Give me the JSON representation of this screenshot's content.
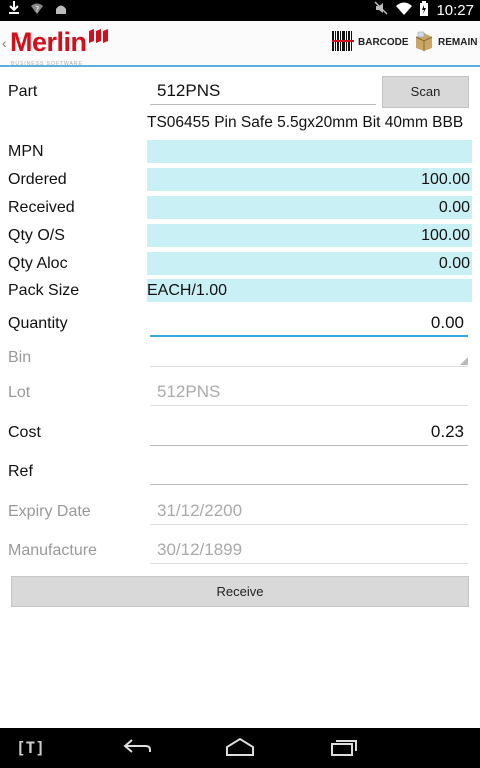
{
  "status_bar": {
    "time": "10:27",
    "icons": [
      "download-icon",
      "wifi-question-icon",
      "android-icon",
      "mute-icon",
      "wifi-icon",
      "battery-icon"
    ]
  },
  "action_bar": {
    "logo_text": "Merlin",
    "logo_tagline": "BUSINESS SOFTWARE",
    "barcode_label": "BARCODE",
    "remain_label": "REMAIN"
  },
  "form": {
    "part": {
      "label": "Part",
      "value": "512PNS",
      "scan_label": "Scan"
    },
    "description": "TS06455 Pin Safe 5.5gx20mm Bit 40mm BBB",
    "mpn": {
      "label": "MPN",
      "value": ""
    },
    "ordered": {
      "label": "Ordered",
      "value": "100.00"
    },
    "received": {
      "label": "Received",
      "value": "0.00"
    },
    "qty_os": {
      "label": "Qty O/S",
      "value": "100.00"
    },
    "qty_aloc": {
      "label": "Qty Aloc",
      "value": "0.00"
    },
    "pack_size": {
      "label": "Pack Size",
      "value": "EACH/1.00"
    },
    "quantity": {
      "label": "Quantity",
      "value": "0.00"
    },
    "bin": {
      "label": "Bin",
      "value": ""
    },
    "lot": {
      "label": "Lot",
      "value": "512PNS"
    },
    "cost": {
      "label": "Cost",
      "value": "0.23"
    },
    "ref": {
      "label": "Ref",
      "value": ""
    },
    "expiry_date": {
      "label": "Expiry Date",
      "value": "31/12/2200"
    },
    "manufacture": {
      "label": "Manufacture",
      "value": "30/12/1899"
    },
    "receive_label": "Receive"
  },
  "nav_bar": {
    "t_label": "[T]",
    "icons": [
      "back-icon",
      "home-icon",
      "recent-apps-icon"
    ]
  },
  "colors": {
    "brand_red": "#d0101c",
    "readonly_field": "#c9f0f5",
    "accent_blue": "#33aadd"
  }
}
